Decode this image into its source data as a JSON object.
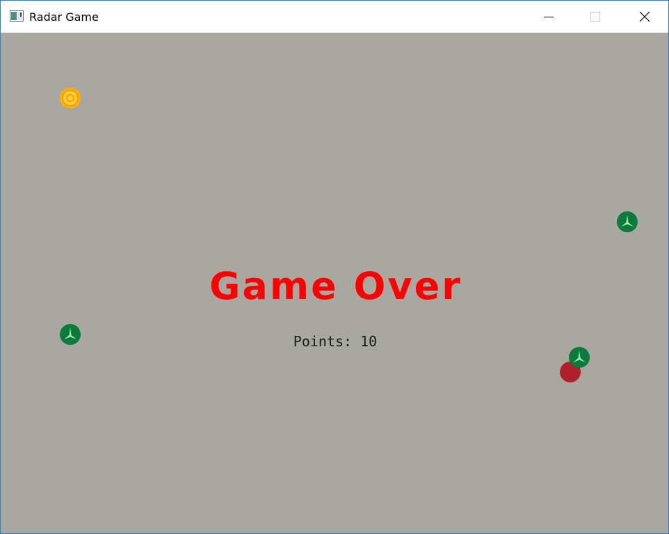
{
  "window": {
    "title": "Radar Game",
    "app_icon": "app-window-icon",
    "controls": {
      "minimize_icon": "minimize-icon",
      "maximize_icon": "maximize-icon",
      "close_icon": "close-icon"
    }
  },
  "game": {
    "background_color": "#a8a8a0",
    "game_over_text": "Game Over",
    "game_over_color": "#ff0000",
    "points_text": "Points: 10",
    "sprites": {
      "target": {
        "icon": "target-coin-icon",
        "color": "#ffb800"
      },
      "enemies": {
        "icon": "green-ship-icon",
        "color": "#0b7a3a",
        "count": 3
      },
      "player": {
        "icon": "red-ball-icon",
        "color": "#b0202a"
      }
    }
  }
}
